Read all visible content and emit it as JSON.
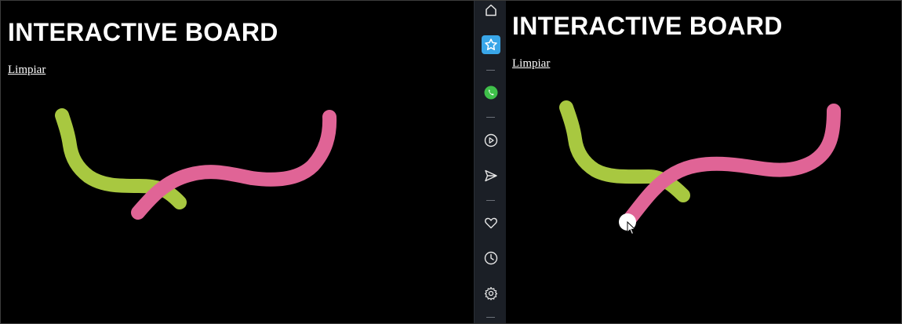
{
  "left_board": {
    "title": "INTERACTIVE BOARD",
    "clear_label": "Limpiar"
  },
  "right_board": {
    "title": "INTERACTIVE BOARD",
    "clear_label": "Limpiar"
  },
  "sidebar": {
    "items": [
      {
        "icon": "home-icon"
      },
      {
        "icon": "star-icon",
        "active": true
      },
      {
        "icon": "whatsapp-icon"
      },
      {
        "icon": "play-icon"
      },
      {
        "icon": "send-icon"
      },
      {
        "icon": "heart-icon"
      },
      {
        "icon": "clock-icon"
      },
      {
        "icon": "gear-icon"
      }
    ]
  },
  "colors": {
    "background": "#000000",
    "stroke_green": "#a8c840",
    "stroke_pink": "#e06496",
    "sidebar_bg": "#1b1f26",
    "sidebar_accent": "#39a6e8",
    "whatsapp_green": "#3fc04a"
  }
}
